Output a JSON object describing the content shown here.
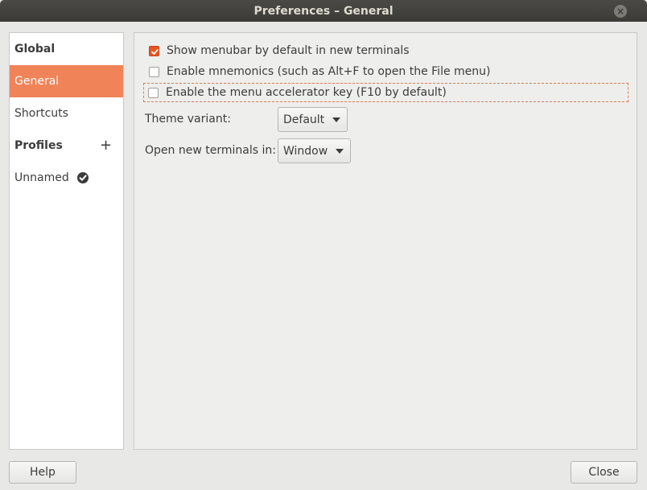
{
  "window": {
    "title": "Preferences – General",
    "close_glyph": "×"
  },
  "sidebar": {
    "items": [
      {
        "label": "Global",
        "type": "header"
      },
      {
        "label": "General",
        "type": "item",
        "selected": true
      },
      {
        "label": "Shortcuts",
        "type": "item"
      },
      {
        "label": "Profiles",
        "type": "header",
        "trailing_icon": "plus-icon"
      },
      {
        "label": "Unnamed",
        "type": "item",
        "trailing_icon": "check-circle-icon"
      }
    ],
    "plus_glyph": "+"
  },
  "general": {
    "checkboxes": [
      {
        "label": "Show menubar by default in new terminals",
        "checked": true
      },
      {
        "label": "Enable mnemonics (such as Alt+F to open the File menu)",
        "checked": false
      },
      {
        "label": "Enable the menu accelerator key (F10 by default)",
        "checked": false,
        "focused": true
      }
    ],
    "theme_variant": {
      "label": "Theme variant:",
      "value": "Default"
    },
    "open_new_terminals": {
      "label": "Open new terminals in:",
      "value": "Window"
    }
  },
  "footer": {
    "help_label": "Help",
    "close_label": "Close"
  },
  "colors": {
    "accent": "#f08358",
    "checkbox_checked": "#e95420",
    "titlebar": "#3c3b37"
  }
}
